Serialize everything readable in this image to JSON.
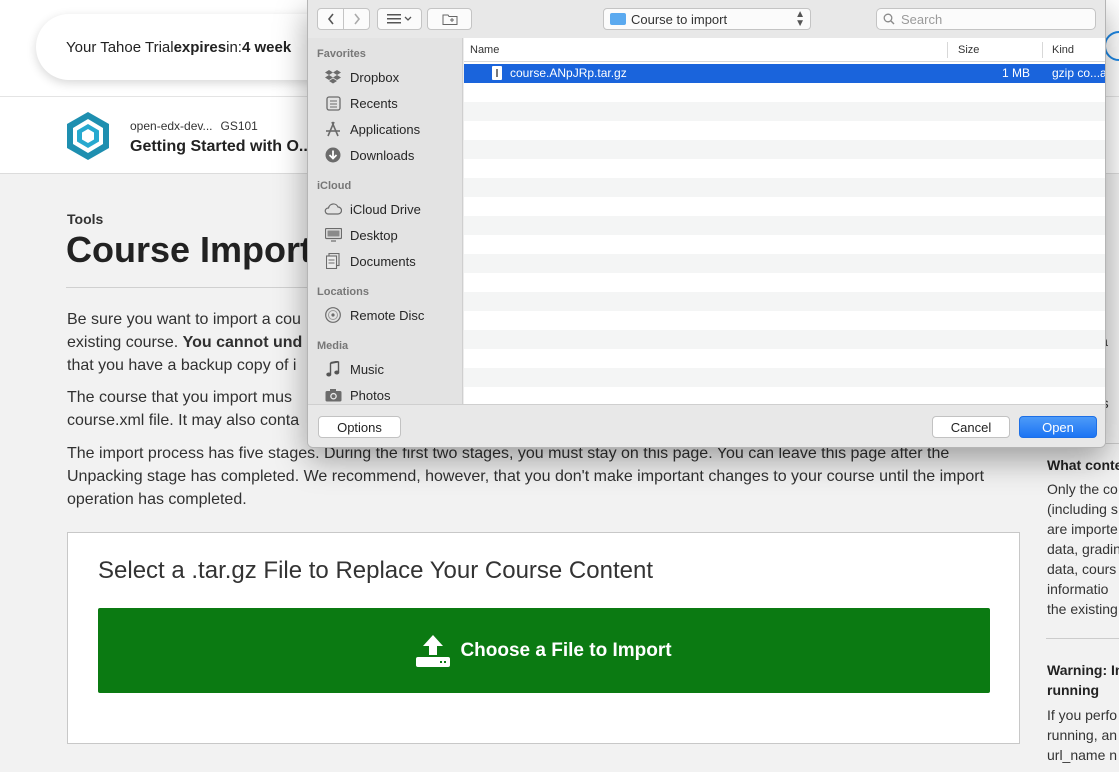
{
  "trial": {
    "prefix": "Your Tahoe Trial ",
    "bold1": "expires",
    "middle": " in: ",
    "bold2": "4 week"
  },
  "course_header": {
    "org": "open-edx-dev...",
    "course_code": "GS101",
    "title": "Getting Started with O..."
  },
  "page": {
    "section": "Tools",
    "title": "Course Import",
    "p1_a": "Be sure you want to import a cou",
    "p1_b": "existing course. ",
    "p1_b_bold": "You cannot und",
    "p1_c": "that you have a backup copy of i",
    "p2_a": "The course that you import mus",
    "p2_b": "course.xml file. It may also conta",
    "p3": "The import process has five stages. During the first two stages, you must stay on this page. You can leave this page after the Unpacking stage has completed. We recommend, however, that you don't make important changes to your course until the import operation has completed.",
    "upload_heading": "Select a .tar.gz File to Replace Your Course Content",
    "choose_button": "Choose a File to Import"
  },
  "right_sidebar": {
    "cut_lines": [
      "or",
      "wa",
      "ou",
      "er.",
      "uts"
    ],
    "what_head": "What conte",
    "what_lines": [
      "Only the co",
      "(including s",
      "are importe",
      "data, gradin",
      "data, cours",
      "informatio",
      "the existing"
    ],
    "warn_head_1": "Warning: In",
    "warn_head_2": "running",
    "warn_lines": [
      "If you perfo",
      "running, an",
      "url_name n"
    ]
  },
  "dialog": {
    "location": "Course to import",
    "search_placeholder": "Search",
    "sidebar": {
      "favorites_label": "Favorites",
      "favorites": [
        {
          "label": "Dropbox",
          "icon": "dropbox-icon"
        },
        {
          "label": "Recents",
          "icon": "recents-icon"
        },
        {
          "label": "Applications",
          "icon": "applications-icon"
        },
        {
          "label": "Downloads",
          "icon": "downloads-icon"
        }
      ],
      "icloud_label": "iCloud",
      "icloud": [
        {
          "label": "iCloud Drive",
          "icon": "cloud-icon"
        },
        {
          "label": "Desktop",
          "icon": "desktop-icon"
        },
        {
          "label": "Documents",
          "icon": "documents-icon"
        }
      ],
      "locations_label": "Locations",
      "locations": [
        {
          "label": "Remote Disc",
          "icon": "disc-icon"
        }
      ],
      "media_label": "Media",
      "media": [
        {
          "label": "Music",
          "icon": "music-icon"
        },
        {
          "label": "Photos",
          "icon": "camera-icon"
        }
      ]
    },
    "columns": {
      "name": "Name",
      "size": "Size",
      "kind": "Kind"
    },
    "files": [
      {
        "name": "course.ANpJRp.tar.gz",
        "size": "1 MB",
        "kind": "gzip co...a",
        "selected": true
      }
    ],
    "buttons": {
      "options": "Options",
      "cancel": "Cancel",
      "open": "Open"
    }
  },
  "colors": {
    "choose_button_green": "#0b7a12",
    "selection_blue": "#1a64dc",
    "open_button_blue": "#1c74f3"
  }
}
